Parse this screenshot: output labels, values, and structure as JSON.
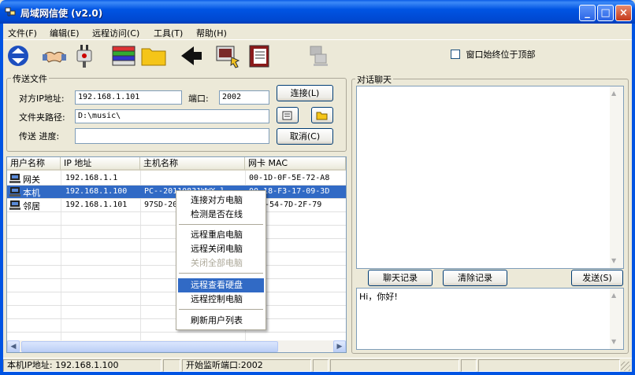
{
  "window": {
    "title": "局域网信使 (v2.0)",
    "min_glyph": "_",
    "max_glyph": "□",
    "close_glyph": "×"
  },
  "menu": [
    "文件(F)",
    "编辑(E)",
    "远程访问(C)",
    "工具(T)",
    "帮助(H)"
  ],
  "toolbar": {
    "always_on_top_label": "窗口始终位于顶部",
    "always_on_top_checked": false
  },
  "transfer": {
    "group_label": "传送文件",
    "ip_label": "对方IP地址:",
    "ip_value": "192.168.1.101",
    "port_label": "端口:",
    "port_value": "2002",
    "connect_label": "连接(L)",
    "folder_label": "文件夹路径:",
    "folder_value": "D:\\music\\",
    "progress_label": "传送 进度:",
    "cancel_label": "取消(C)"
  },
  "userlist": {
    "columns": [
      "用户名称",
      "IP 地址",
      "主机名称",
      "网卡 MAC"
    ],
    "rows": [
      {
        "name": "网关",
        "ip": "192.168.1.1",
        "host": "",
        "mac": "00-1D-0F-5E-72-A8",
        "selected": false
      },
      {
        "name": "本机",
        "ip": "192.168.1.100",
        "host": "PC--20110831WWX.l",
        "mac": "00-18-F3-17-09-3D",
        "selected": true
      },
      {
        "name": "邻居",
        "ip": "192.168.1.101",
        "host": "97SD-20",
        "mac": "4-54-7D-2F-79",
        "selected": false
      }
    ]
  },
  "context_menu": {
    "items": [
      {
        "label": "连接对方电脑",
        "state": "normal"
      },
      {
        "label": "检测是否在线",
        "state": "normal"
      },
      {
        "label": "-",
        "state": "separator"
      },
      {
        "label": "远程重启电脑",
        "state": "normal"
      },
      {
        "label": "远程关闭电脑",
        "state": "normal"
      },
      {
        "label": "关闭全部电脑",
        "state": "disabled"
      },
      {
        "label": "-",
        "state": "separator"
      },
      {
        "label": "远程查看硬盘",
        "state": "highlighted"
      },
      {
        "label": "远程控制电脑",
        "state": "normal"
      },
      {
        "label": "-",
        "state": "separator"
      },
      {
        "label": "刷新用户列表",
        "state": "normal"
      }
    ]
  },
  "chat": {
    "group_label": "对话聊天",
    "history_button": "聊天记录",
    "clear_button": "清除记录",
    "send_button": "发送(S)",
    "input_value": "Hi，你好!"
  },
  "status": {
    "local_ip": "本机IP地址:  192.168.1.100",
    "listen": "开始监听端口:2002"
  },
  "colors": {
    "titlebar": "#0054e3",
    "selection": "#316ac5",
    "face": "#ece9d8"
  }
}
